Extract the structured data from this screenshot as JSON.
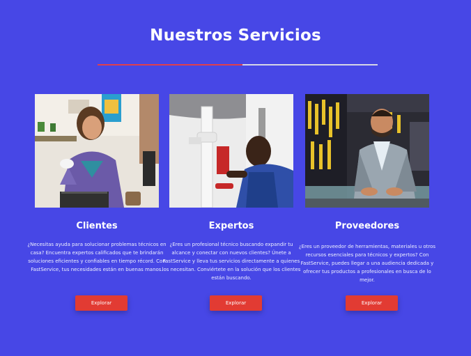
{
  "section": {
    "title": "Nuestros Servicios"
  },
  "colors": {
    "background": "#4747e6",
    "accent": "#e0404b",
    "button": "#e23b33"
  },
  "cards": [
    {
      "title": "Clientes",
      "description": "¿Necesitas ayuda para solucionar problemas técnicos en casa? Encuentra expertos calificados que te brindarán soluciones eficientes y confiables en tiempo récord. Con FastService, tus necesidades están en buenas manos.",
      "button_label": "Explorar",
      "image": "woman-with-tablet-and-mug"
    },
    {
      "title": "Expertos",
      "description": "¿Eres un profesional técnico buscando expandir tu alcance y conectar con nuevos clientes? Únete a FastService y lleva tus servicios directamente a quienes los necesitan. Conviértete en la solución que los clientes están buscando.",
      "button_label": "Explorar",
      "image": "plumber-fixing-sink-pipe"
    },
    {
      "title": "Proveedores",
      "description": "¿Eres un proveedor de herramientas, materiales u otros recursos esenciales para técnicos y expertos? Con FastService, puedes llegar a una audiencia dedicada y ofrecer tus productos a profesionales en busca de lo mejor.",
      "button_label": "Explorar",
      "image": "shopkeeper-at-tool-store-counter"
    }
  ]
}
